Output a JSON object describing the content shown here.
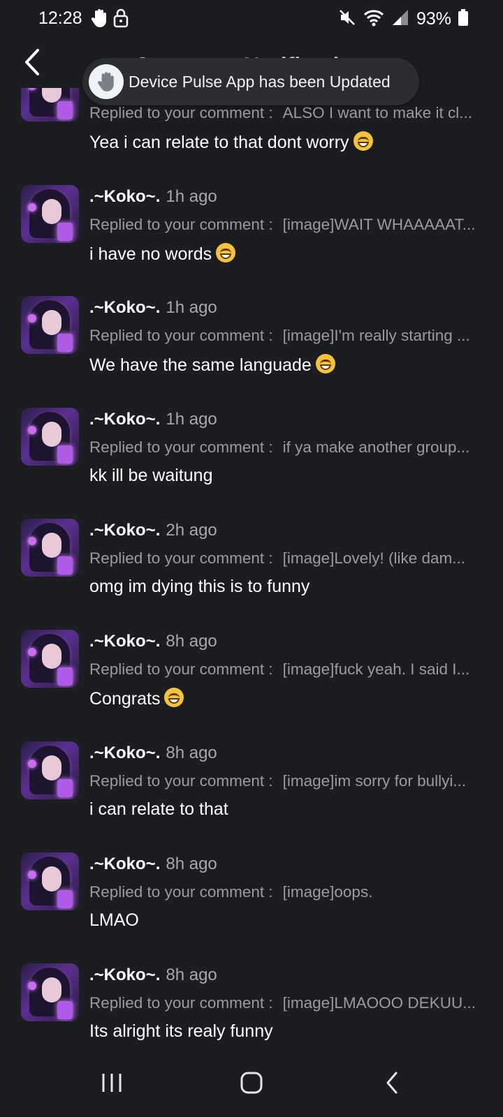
{
  "status_bar": {
    "time": "12:28",
    "battery": "93%",
    "icons": [
      "hand-icon",
      "lock-icon",
      "mute-icon",
      "wifi-icon",
      "signal-icon",
      "battery-icon"
    ]
  },
  "header": {
    "title": "Comment Notification",
    "back_icon": "back-arrow-icon"
  },
  "toast": {
    "icon": "hand-icon",
    "text": "Device Pulse App has been Updated"
  },
  "notifications": [
    {
      "username": "",
      "time": "",
      "replied_label": "Replied to your comment :",
      "original": "ALSO I want to make it cl...",
      "reply": "Yea i can relate to that dont worry",
      "emoji": true
    },
    {
      "username": ".~Koko~.",
      "time": "1h ago",
      "replied_label": "Replied to your comment :",
      "original": "[image]WAIT WHAAAAAT...",
      "reply": "i have no words",
      "emoji": true
    },
    {
      "username": ".~Koko~.",
      "time": "1h ago",
      "replied_label": "Replied to your comment :",
      "original": "[image]I'm really starting ...",
      "reply": "We have the same languade",
      "emoji": true
    },
    {
      "username": ".~Koko~.",
      "time": "1h ago",
      "replied_label": "Replied to your comment :",
      "original": "if ya make another group...",
      "reply": "kk ill be waitung",
      "emoji": false
    },
    {
      "username": ".~Koko~.",
      "time": "2h ago",
      "replied_label": "Replied to your comment :",
      "original": "[image]Lovely! (like dam...",
      "reply": "omg im dying this is to funny",
      "emoji": false
    },
    {
      "username": ".~Koko~.",
      "time": "8h ago",
      "replied_label": "Replied to your comment :",
      "original": "[image]fuck yeah. I said I...",
      "reply": "Congrats",
      "emoji": true
    },
    {
      "username": ".~Koko~.",
      "time": "8h ago",
      "replied_label": "Replied to your comment :",
      "original": "[image]im sorry for bullyi...",
      "reply": "i can relate to that",
      "emoji": false
    },
    {
      "username": ".~Koko~.",
      "time": "8h ago",
      "replied_label": "Replied to your comment :",
      "original": "[image]oops.",
      "reply": "LMAO",
      "emoji": false
    },
    {
      "username": ".~Koko~.",
      "time": "8h ago",
      "replied_label": "Replied to your comment :",
      "original": "[image]LMAOOO DEKUU...",
      "reply": "Its alright its realy funny",
      "emoji": false
    }
  ],
  "nav_bar": {
    "buttons": [
      "recent-apps-icon",
      "home-icon",
      "back-icon"
    ]
  }
}
